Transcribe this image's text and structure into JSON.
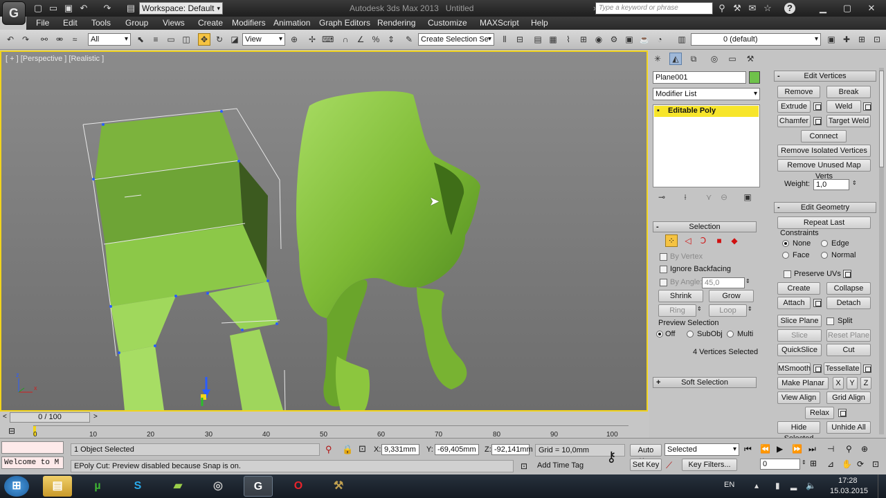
{
  "titlebar": {
    "app_title": "Autodesk 3ds Max  2013",
    "doc_title": "Untitled",
    "workspace": "Workspace: Default",
    "search_placeholder": "Type a keyword or phrase"
  },
  "menu": [
    "File",
    "Edit",
    "Tools",
    "Group",
    "Views",
    "Create",
    "Modifiers",
    "Animation",
    "Graph Editors",
    "Rendering",
    "Customize",
    "MAXScript",
    "Help"
  ],
  "toolbar": {
    "filter": "All",
    "ref_coord": "View",
    "named_selection": "Create Selection Se",
    "layer": "0 (default)"
  },
  "viewport": {
    "label": "[ + ] [Perspective ] [Realistic ]",
    "axis_x": "x",
    "axis_z": "z",
    "accent": "#f2d41c",
    "model_color": "#8cc63e"
  },
  "command_panel": {
    "object_name": "Plane001",
    "object_color": "#6fc24b",
    "modifier_list": "Modifier List",
    "stack_item": "Editable Poly",
    "selection": {
      "title": "Selection",
      "by_vertex": "By Vertex",
      "ignore_backfacing": "Ignore Backfacing",
      "by_angle": "By Angle:",
      "angle_value": "45,0",
      "shrink": "Shrink",
      "grow": "Grow",
      "ring": "Ring",
      "loop": "Loop",
      "preview_title": "Preview Selection",
      "preview_off": "Off",
      "preview_subobj": "SubObj",
      "preview_multi": "Multi",
      "status": "4 Vertices Selected"
    },
    "soft_selection": "Soft Selection",
    "edit_vertices": {
      "title": "Edit Vertices",
      "remove": "Remove",
      "break": "Break",
      "extrude": "Extrude",
      "weld": "Weld",
      "chamfer": "Chamfer",
      "target_weld": "Target Weld",
      "connect": "Connect",
      "remove_isolated": "Remove Isolated Vertices",
      "remove_unused": "Remove Unused Map Verts",
      "weight_label": "Weight:",
      "weight_value": "1,0"
    },
    "edit_geometry": {
      "title": "Edit Geometry",
      "repeat_last": "Repeat Last",
      "constraints": "Constraints",
      "c_none": "None",
      "c_edge": "Edge",
      "c_face": "Face",
      "c_normal": "Normal",
      "preserve_uvs": "Preserve UVs",
      "create": "Create",
      "collapse": "Collapse",
      "attach": "Attach",
      "detach": "Detach",
      "slice_plane": "Slice Plane",
      "split": "Split",
      "slice": "Slice",
      "reset_plane": "Reset Plane",
      "quickslice": "QuickSlice",
      "cut": "Cut",
      "msmooth": "MSmooth",
      "tessellate": "Tessellate",
      "make_planar": "Make Planar",
      "x": "X",
      "y": "Y",
      "z": "Z",
      "view_align": "View Align",
      "grid_align": "Grid Align",
      "relax": "Relax",
      "hide_selected": "Hide Selected",
      "unhide_all": "Unhide All"
    }
  },
  "timeline": {
    "frame": "0 / 100",
    "ticks": [
      "0",
      "10",
      "20",
      "30",
      "40",
      "50",
      "60",
      "70",
      "80",
      "90",
      "100"
    ]
  },
  "status": {
    "objects_selected": "1 Object Selected",
    "prompt": "EPoly Cut: Preview disabled because Snap is on.",
    "maxscript": "Welcome to M",
    "x_label": "X:",
    "x_value": "9,331mm",
    "y_label": "Y:",
    "y_value": "-69,405mm",
    "z_label": "Z:",
    "z_value": "-92,141mm",
    "grid": "Grid = 10,0mm",
    "add_time_tag": "Add Time Tag",
    "auto_key": "Auto Key",
    "set_key": "Set Key",
    "key_mode": "Selected",
    "key_filters": "Key Filters...",
    "current_frame": "0"
  },
  "taskbar": {
    "lang": "EN",
    "time": "17:28",
    "date": "15.03.2015"
  }
}
